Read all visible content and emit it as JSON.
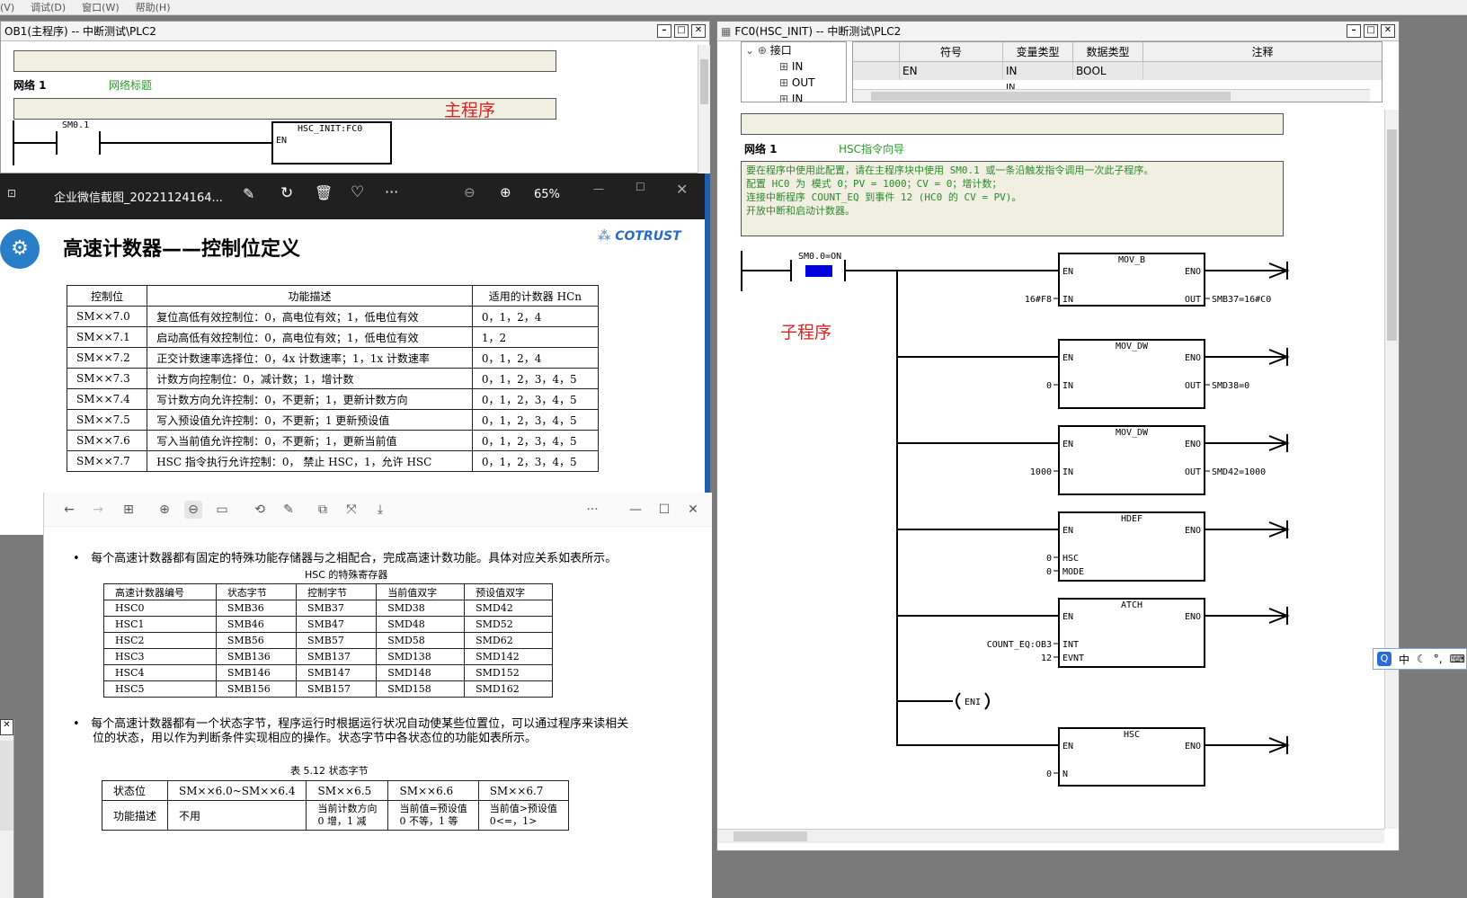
{
  "menubar": [
    "(V)",
    "调试(D)",
    "窗口(W)",
    "帮助(H)"
  ],
  "ob1": {
    "title": "OB1(主程序) -- 中断测试\\PLC2",
    "network_label": "网络 1",
    "network_title": "网络标题",
    "main_label": "主程序",
    "contact": "SM0.1",
    "box_title": "HSC_INIT:FC0",
    "box_en": "EN"
  },
  "fc0": {
    "title": "FC0(HSC_INIT) -- 中断测试\\PLC2",
    "tree": [
      "接口",
      "IN",
      "OUT",
      "IN"
    ],
    "iface_headers": [
      "符号",
      "变量类型",
      "数据类型",
      "注释"
    ],
    "iface_row": [
      "EN",
      "IN",
      "BOOL",
      ""
    ],
    "iface_row2": [
      "",
      "IN",
      "",
      ""
    ],
    "network_label": "网络 1",
    "network_title": "HSC指令向导",
    "comment": [
      "要在程序中使用此配置，请在主程序块中使用 SM0.1 或一条沿触发指令调用一次此子程序。",
      "配置 HC0 为 模式 0；PV = 1000；CV = 0；增计数；",
      "连接中断程序 COUNT_EQ 到事件 12 (HC0 的 CV = PV)。",
      "开放中断和启动计数器。"
    ],
    "contact": "SM0.0=ON",
    "sub_label": "子程序",
    "boxes": [
      {
        "name": "MOV_B",
        "in1_label": "IN",
        "in1_val": "16#F8",
        "out_label": "OUT",
        "out_val": "SMB37=16#C0",
        "in2_label": "",
        "in2_val": ""
      },
      {
        "name": "MOV_DW",
        "in1_label": "IN",
        "in1_val": "0",
        "out_label": "OUT",
        "out_val": "SMD38=0",
        "in2_label": "",
        "in2_val": ""
      },
      {
        "name": "MOV_DW",
        "in1_label": "IN",
        "in1_val": "1000",
        "out_label": "OUT",
        "out_val": "SMD42=1000",
        "in2_label": "",
        "in2_val": ""
      },
      {
        "name": "HDEF",
        "in1_label": "HSC",
        "in1_val": "0",
        "out_label": "",
        "out_val": "",
        "in2_label": "MODE",
        "in2_val": "0"
      },
      {
        "name": "ATCH",
        "in1_label": "INT",
        "in1_val": "COUNT_EQ:OB3",
        "out_label": "",
        "out_val": "",
        "in2_label": "EVNT",
        "in2_val": "12"
      },
      {
        "name": "HSC",
        "in1_label": "N",
        "in1_val": "0",
        "out_label": "",
        "out_val": "",
        "in2_label": "",
        "in2_val": ""
      }
    ],
    "en": "EN",
    "eno": "ENO",
    "eni": "ENI"
  },
  "viewer": {
    "filename": "企业微信截图_20221124164...",
    "zoom": "65%",
    "heading": "高速计数器——控制位定义",
    "logo": "COTRUST",
    "headers": [
      "控制位",
      "功能描述",
      "适用的计数器 HCn"
    ],
    "rows": [
      [
        "SM××7.0",
        "复位高低有效控制位：0，高电位有效；1，低电位有效",
        "0，1，2，4"
      ],
      [
        "SM××7.1",
        "启动高低有效控制位：0，高电位有效；1，低电位有效",
        "1，2"
      ],
      [
        "SM××7.2",
        "正交计数速率选择位：0，4x 计数速率；1，1x 计数速率",
        "0，1，2，4"
      ],
      [
        "SM××7.3",
        "计数方向控制位：0，减计数；1，增计数",
        "0，1，2，3，4，5"
      ],
      [
        "SM××7.4",
        "写计数方向允许控制：0，不更新；1，更新计数方向",
        "0，1，2，3，4，5"
      ],
      [
        "SM××7.5",
        "写入预设值允许控制：0，不更新；1 更新预设值",
        "0，1，2，3，4，5"
      ],
      [
        "SM××7.6",
        "写入当前值允许控制：0，不更新；1，更新当前值",
        "0，1，2，3，4，5"
      ],
      [
        "SM××7.7",
        "HSC 指令执行允许控制：0， 禁止 HSC，1，允许 HSC",
        "0，1，2，3，4，5"
      ]
    ]
  },
  "doc": {
    "bullet1": "每个高速计数器都有固定的特殊功能存储器与之相配合，完成高速计数功能。具体对应关系如表所示。",
    "caption1": "HSC 的特殊寄存器",
    "headers1": [
      "高速计数器编号",
      "状态字节",
      "控制字节",
      "当前值双字",
      "预设值双字"
    ],
    "rows1": [
      [
        "HSC0",
        "SMB36",
        "SMB37",
        "SMD38",
        "SMD42"
      ],
      [
        "HSC1",
        "SMB46",
        "SMB47",
        "SMD48",
        "SMD52"
      ],
      [
        "HSC2",
        "SMB56",
        "SMB57",
        "SMD58",
        "SMD62"
      ],
      [
        "HSC3",
        "SMB136",
        "SMB137",
        "SMD138",
        "SMD142"
      ],
      [
        "HSC4",
        "SMB146",
        "SMB147",
        "SMD148",
        "SMD152"
      ],
      [
        "HSC5",
        "SMB156",
        "SMB157",
        "SMD158",
        "SMD162"
      ]
    ],
    "bullet2a": "每个高速计数器都有一个状态字节，程序运行时根据运行状况自动使某些位置位，可以通过程序来读相关",
    "bullet2b": "位的状态，用以作为判断条件实现相应的操作。状态字节中各状态位的功能如表所示。",
    "caption2": "表 5.12   状态字节",
    "r1": [
      "状态位",
      "SM××6.0~SM××6.4",
      "SM××6.5",
      "SM××6.6",
      "SM××6.7"
    ],
    "r2": [
      "功能描述",
      "不用",
      "当前计数方向",
      "当前值=预设值",
      "当前值>预设值"
    ],
    "r3": [
      "",
      "",
      "0 增，1 减",
      "0 不等，1 等",
      "0<=，1>"
    ]
  },
  "ime": {
    "lang": "中"
  }
}
